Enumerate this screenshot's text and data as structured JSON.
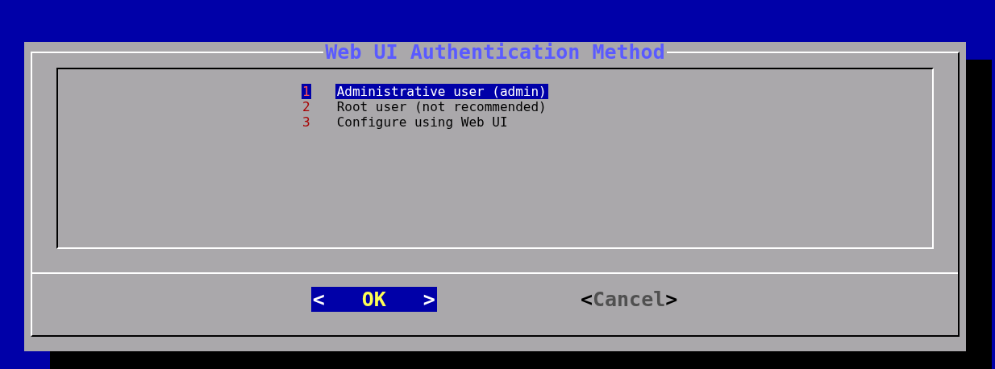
{
  "dialog": {
    "title": "Web UI Authentication Method",
    "items": [
      {
        "number": "1",
        "label": "Administrative user (admin)",
        "selected": true
      },
      {
        "number": "2",
        "label": "Root user (not recommended)",
        "selected": false
      },
      {
        "number": "3",
        "label": "Configure using Web UI",
        "selected": false
      }
    ],
    "buttons": [
      {
        "open": "<",
        "label": "OK",
        "close": ">",
        "selected": true
      },
      {
        "open": "<",
        "label": "Cancel",
        "close": ">",
        "selected": false
      }
    ]
  }
}
